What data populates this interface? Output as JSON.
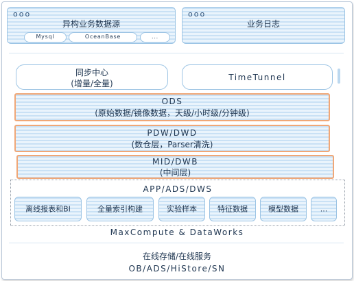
{
  "sources": {
    "window_dots": "ooo",
    "title": "异构业务数据源",
    "items": [
      "Mysql",
      "OceanBase",
      "..."
    ]
  },
  "logs": {
    "window_dots": "ooo",
    "title": "业务日志"
  },
  "sync_center": {
    "title": "同步中心",
    "subtitle": "(增量/全量)"
  },
  "timetunnel": {
    "title": "TimeTunnel"
  },
  "ods": {
    "title": "ODS",
    "subtitle": "(原始数据/镜像数据，天级/小时级/分钟级)"
  },
  "pdw": {
    "title": "PDW/DWD",
    "subtitle": "(数仓层，Parser清洗)"
  },
  "mid": {
    "title": "MID/DWB",
    "subtitle": "(中间层)"
  },
  "app": {
    "title": "APP/ADS/DWS",
    "items": [
      "离线报表和BI",
      "全量索引构建",
      "实验样本",
      "特征数据",
      "模型数据",
      "..."
    ]
  },
  "platform": {
    "title": "MaxCompute & DataWorks"
  },
  "online": {
    "title": "在线存储/在线服务",
    "subtitle": "OB/ADS/HiStore/SN"
  }
}
